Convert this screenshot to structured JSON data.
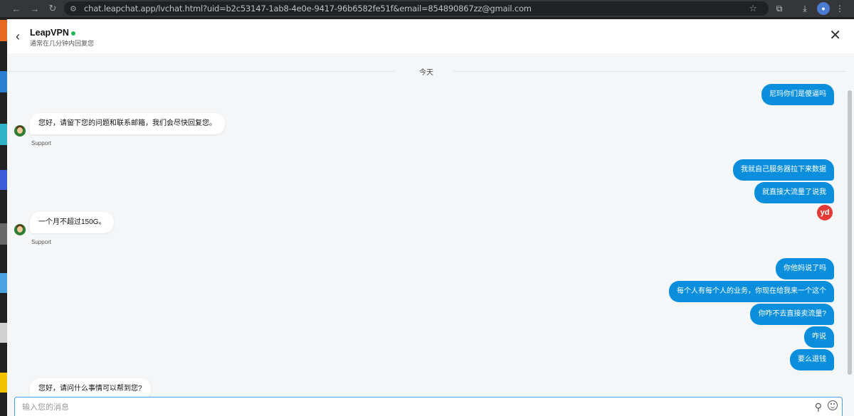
{
  "browser": {
    "url": "chat.leapchat.app/lvchat.html?uid=b2c53147-1ab8-4e0e-9417-96b6582fe51f&email=854890867zz@gmail.com",
    "back_icon": "←",
    "forward_icon": "→",
    "reload_icon": "↻",
    "site_info_icon": "⚙",
    "star_icon": "☆",
    "extensions_icon": "⧉",
    "download_icon": "⤓",
    "menu_icon": "⋮"
  },
  "header": {
    "title": "LeapVPN",
    "subtitle": "通常在几分钟内回复您",
    "back_icon": "‹",
    "close_icon": "✕",
    "online_color": "#1db954"
  },
  "chat": {
    "date_label": "今天",
    "sender_name": "Support",
    "messages_out": [
      "尼玛你们是傻逼吗",
      "我就自己服务器拉下来数据",
      "就直接大流量了说我",
      "你他妈说了吗",
      "每个人有每个人的业务，你现在给我来一个这个",
      "你咋不去直接卖流量?",
      "咋说",
      "要么退钱"
    ],
    "messages_in": [
      "您好，请留下您的问题和联系邮箱，我们会尽快回复您。",
      "一个月不超过150G。",
      "您好，请问什么事情可以帮到您?"
    ],
    "badge_text": "yd"
  },
  "composer": {
    "placeholder": "输入您的消息",
    "attach_icon": "paperclip",
    "emoji_icon": "smiley"
  },
  "colors": {
    "outgoing_bubble": "#0b8fdc",
    "incoming_bubble": "#ffffff",
    "background": "#f4f6f8",
    "accent_border": "#4a9ee8"
  }
}
